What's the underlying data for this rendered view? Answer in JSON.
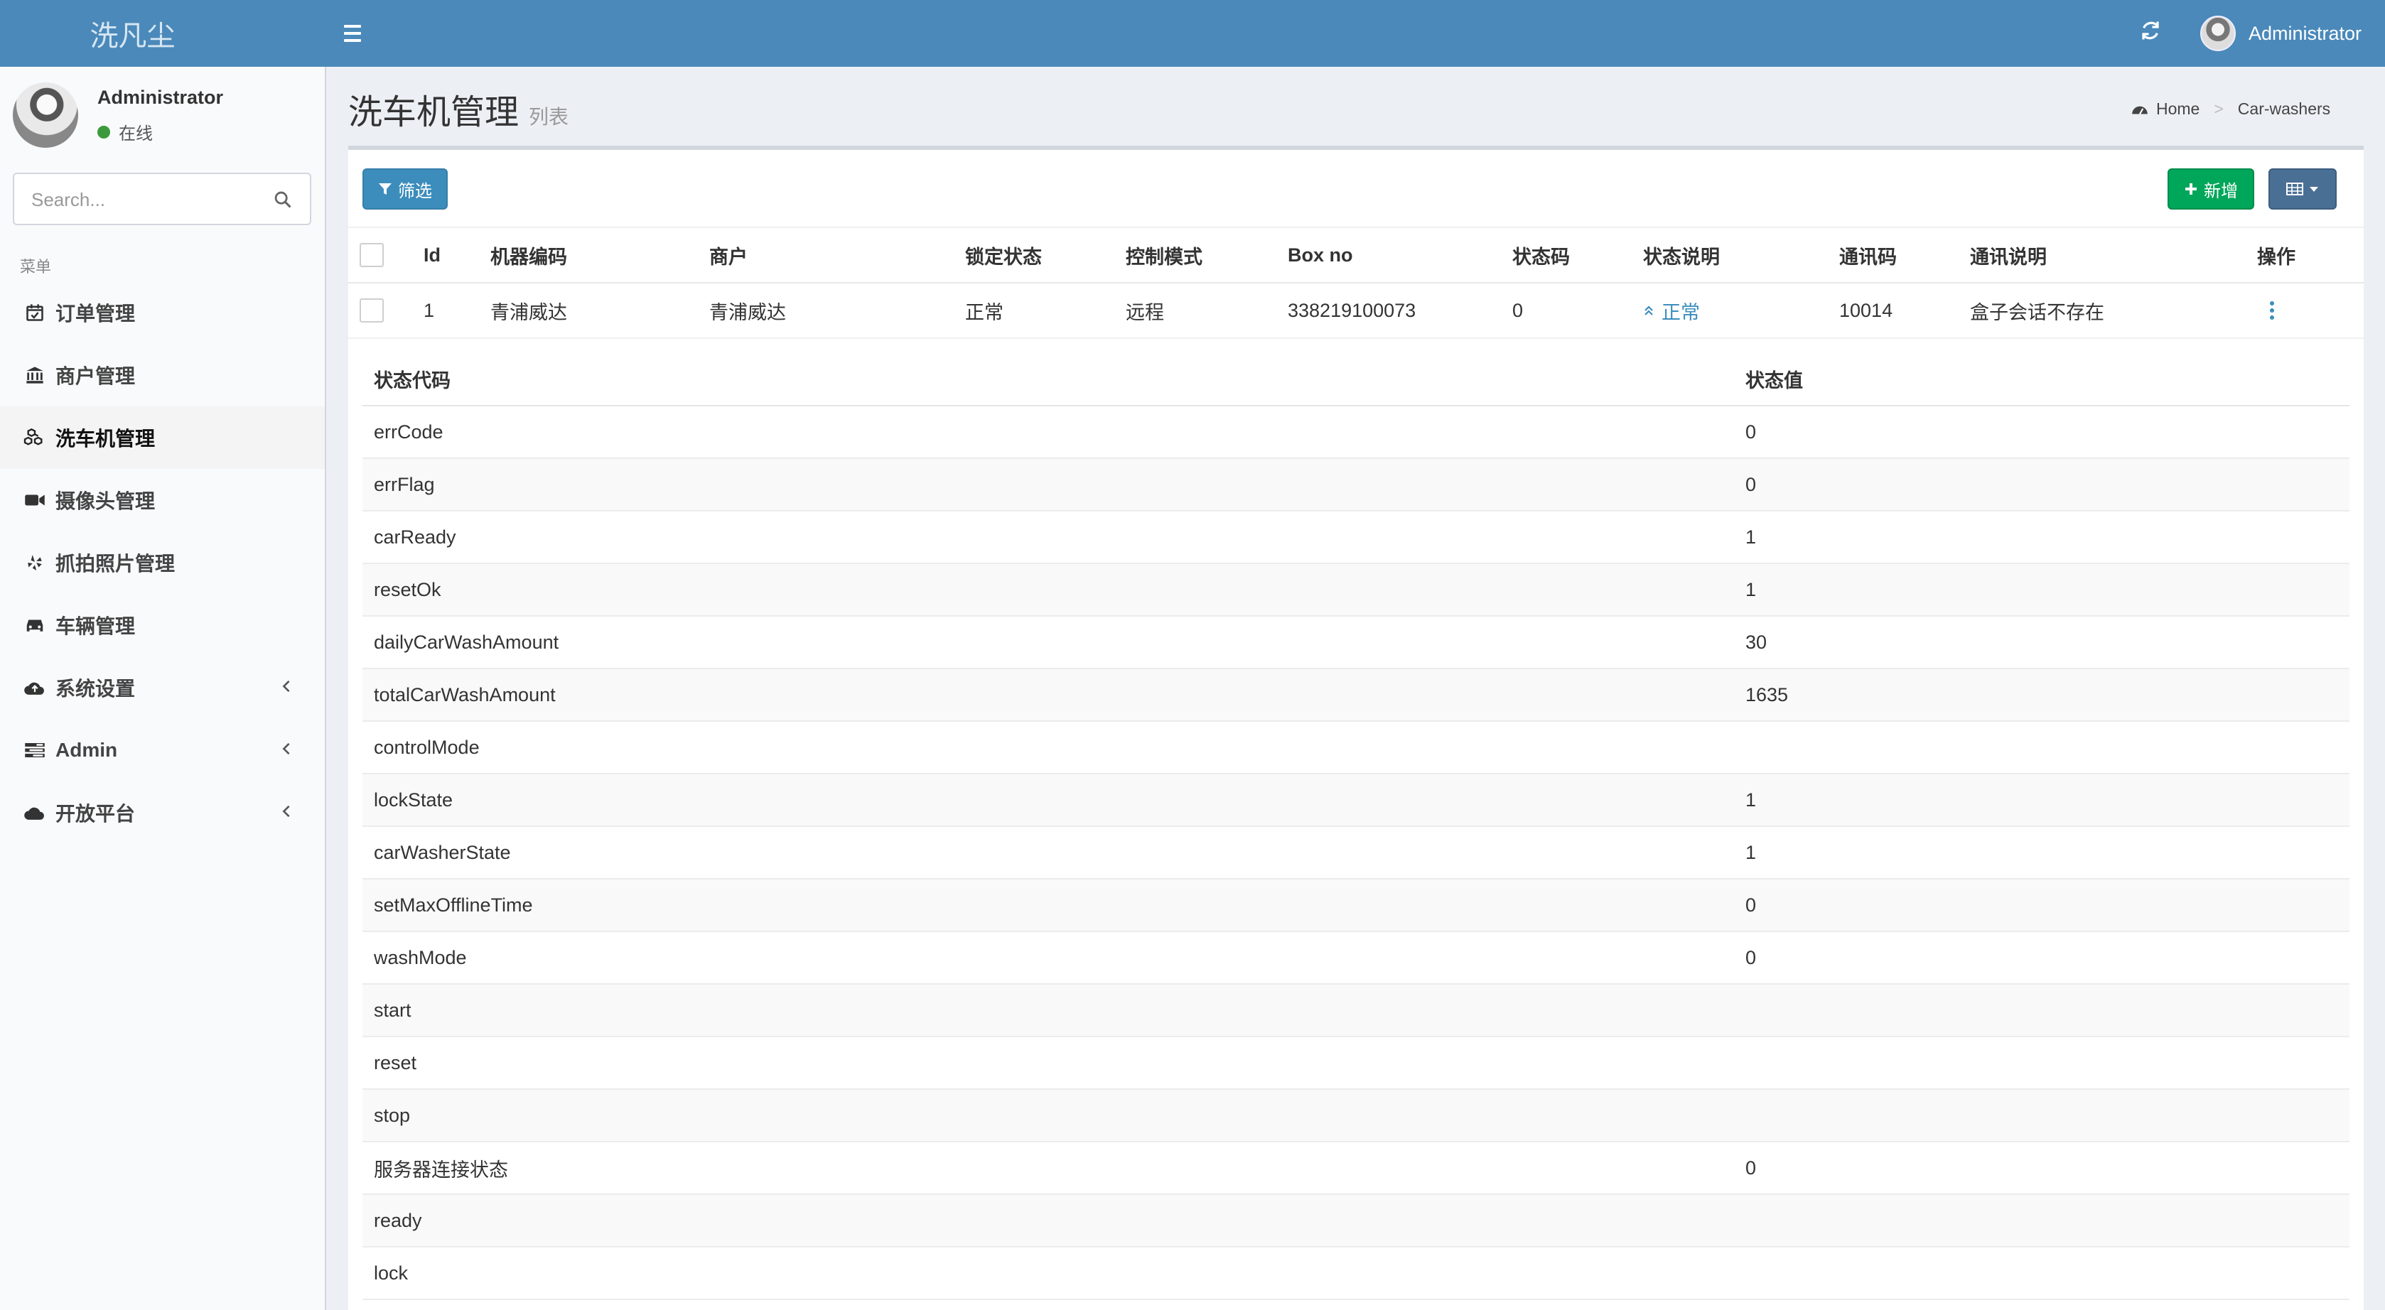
{
  "header": {
    "brand": "洗凡尘",
    "user_name": "Administrator"
  },
  "sidebar": {
    "user": {
      "name": "Administrator",
      "status": "在线"
    },
    "search_placeholder": "Search...",
    "menu_heading": "菜单",
    "items": [
      {
        "label": "订单管理",
        "icon": "calendar-check-icon"
      },
      {
        "label": "商户管理",
        "icon": "bank-icon"
      },
      {
        "label": "洗车机管理",
        "icon": "cubes-icon",
        "active": true
      },
      {
        "label": "摄像头管理",
        "icon": "video-camera-icon"
      },
      {
        "label": "抓拍照片管理",
        "icon": "yelp-icon"
      },
      {
        "label": "车辆管理",
        "icon": "car-icon"
      },
      {
        "label": "系统设置",
        "icon": "cloud-upload-icon",
        "has_children": true
      },
      {
        "label": "Admin",
        "icon": "tasks-icon",
        "has_children": true
      },
      {
        "label": "开放平台",
        "icon": "cloud-icon",
        "has_children": true
      }
    ]
  },
  "content": {
    "title": "洗车机管理",
    "subtitle": "列表",
    "breadcrumb": [
      "Home",
      "Car-washers"
    ]
  },
  "toolbar": {
    "filter_label": "筛选",
    "add_label": "新增"
  },
  "table": {
    "headers": [
      "Id",
      "机器编码",
      "商户",
      "锁定状态",
      "控制模式",
      "Box no",
      "状态码",
      "状态说明",
      "通讯码",
      "通讯说明",
      "操作"
    ],
    "rows": [
      {
        "id": "1",
        "machine_code": "青浦威达",
        "merchant": "青浦威达",
        "lock_state": "正常",
        "control_mode": "远程",
        "box_no": "338219100073",
        "status_code": "0",
        "status_desc": "正常",
        "comm_code": "10014",
        "comm_desc": "盒子会话不存在"
      }
    ]
  },
  "detail": {
    "headers": [
      "状态代码",
      "状态值"
    ],
    "rows": [
      {
        "code": "errCode",
        "value": "0"
      },
      {
        "code": "errFlag",
        "value": "0"
      },
      {
        "code": "carReady",
        "value": "1"
      },
      {
        "code": "resetOk",
        "value": "1"
      },
      {
        "code": "dailyCarWashAmount",
        "value": "30"
      },
      {
        "code": "totalCarWashAmount",
        "value": "1635"
      },
      {
        "code": "controlMode",
        "value": ""
      },
      {
        "code": "lockState",
        "value": "1"
      },
      {
        "code": "carWasherState",
        "value": "1"
      },
      {
        "code": "setMaxOfflineTime",
        "value": "0"
      },
      {
        "code": "washMode",
        "value": "0"
      },
      {
        "code": "start",
        "value": ""
      },
      {
        "code": "reset",
        "value": ""
      },
      {
        "code": "stop",
        "value": ""
      },
      {
        "code": "服务器连接状态",
        "value": "0"
      },
      {
        "code": "ready",
        "value": ""
      },
      {
        "code": "lock",
        "value": ""
      }
    ]
  },
  "colors": {
    "header_bg": "#4a89ba",
    "primary": "#3c8dbc",
    "success": "#00a65a",
    "online": "#3c9a3c"
  }
}
